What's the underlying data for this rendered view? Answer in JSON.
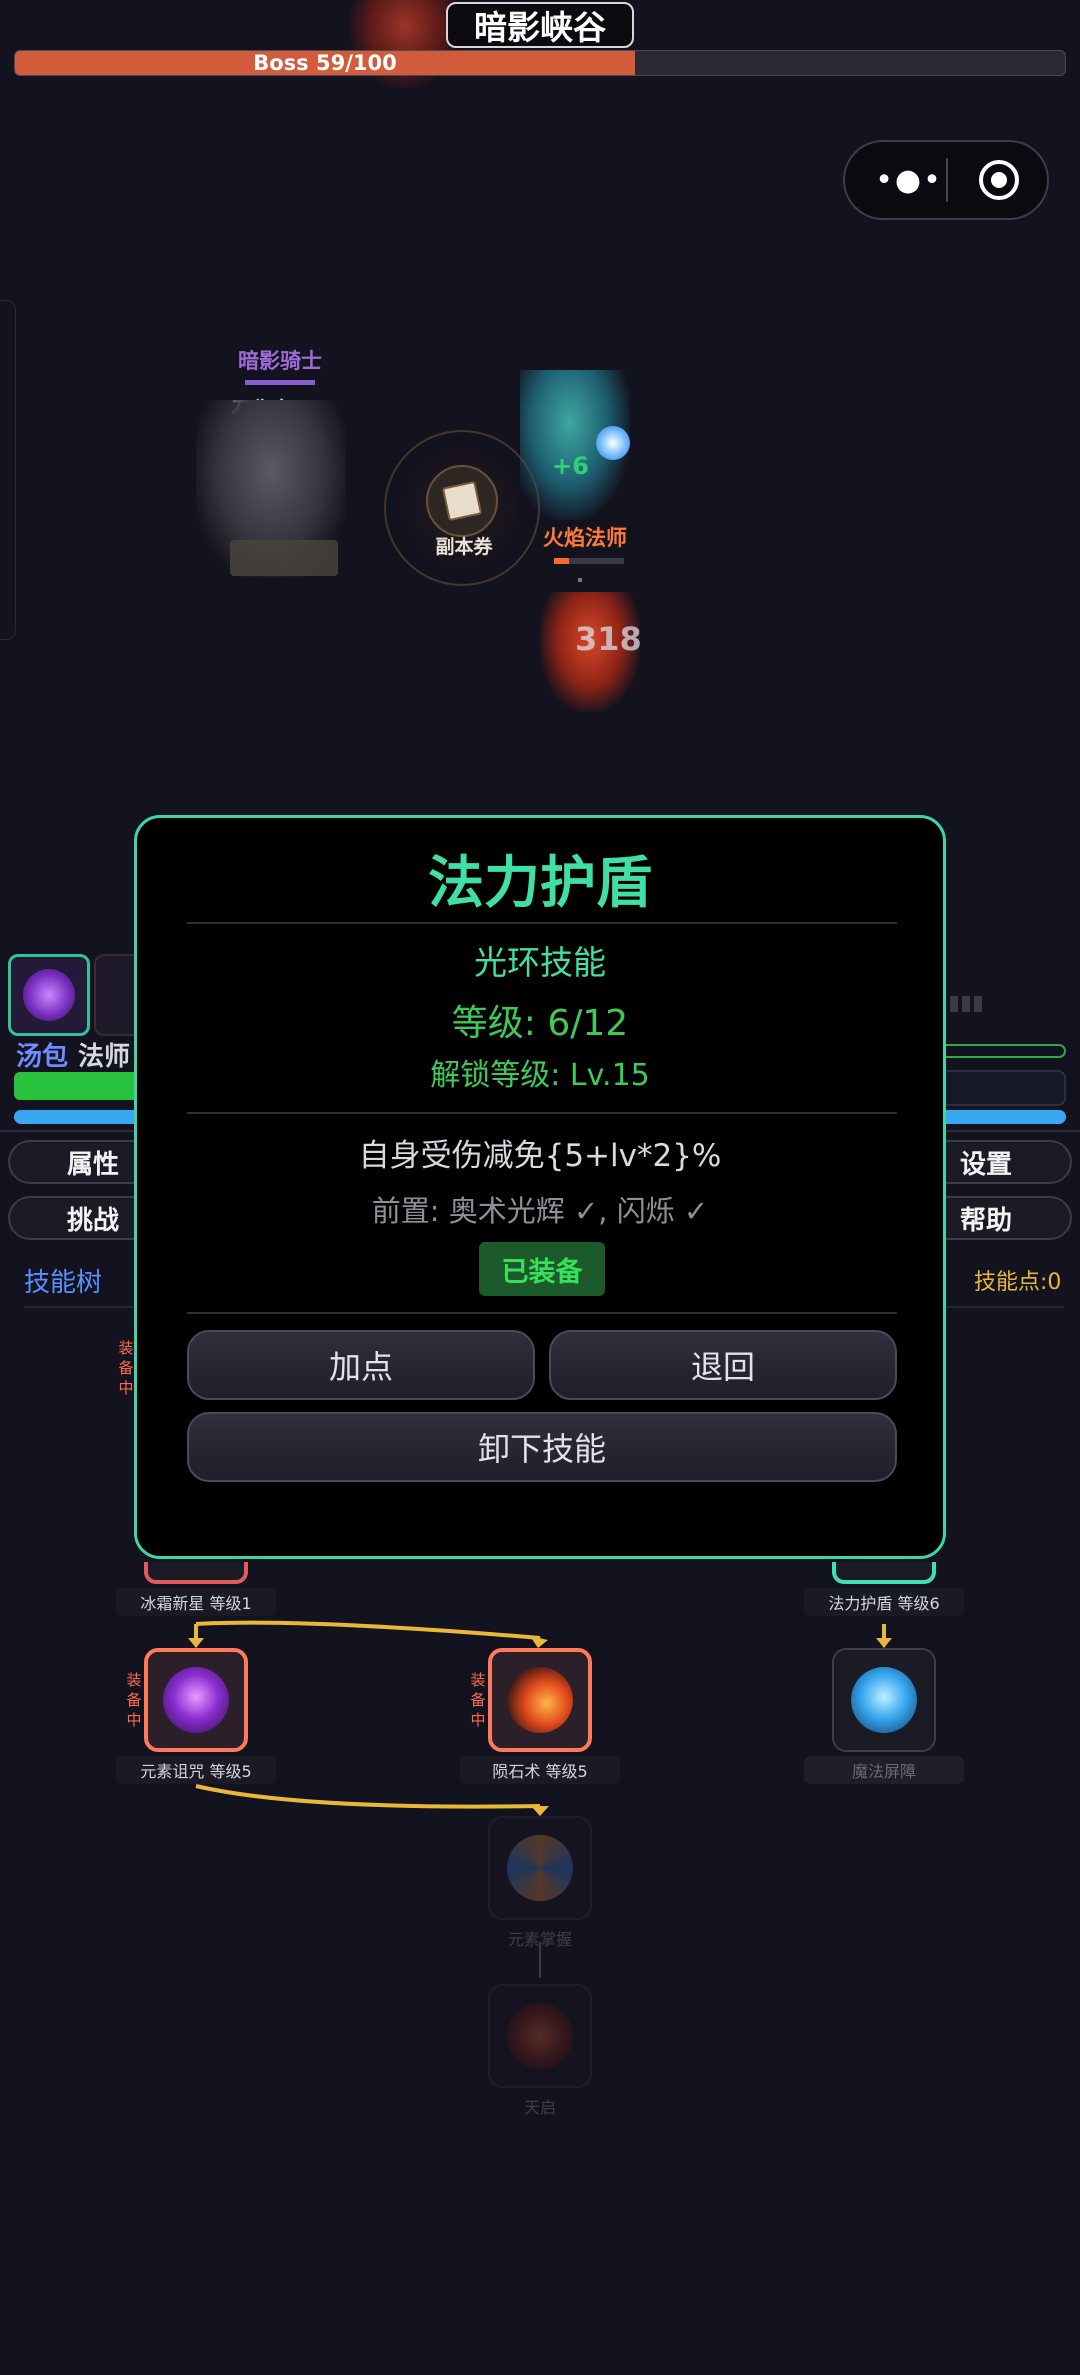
{
  "header": {
    "zone_title": "暗影峡谷",
    "boss_label": "Boss 59/100",
    "boss_progress": 0.59
  },
  "capsule": {
    "more_glyph": "•●•",
    "close_icon": "target-icon"
  },
  "battle": {
    "enemy_name": "暗影骑士",
    "enemy_sub_name": "石像鬼",
    "ticket_label": "副本券",
    "mage_float_text": "+6",
    "fire_mage_name": "火焰法师",
    "fire_mage_hp": 0.22,
    "damage_number": "318"
  },
  "hud": {
    "hero_name": "汤包",
    "hero_class": "法师",
    "buttons": {
      "attributes": "属性",
      "challenge": "挑战",
      "settings": "设置",
      "help": "帮助"
    },
    "tab_skill_tree": "技能树",
    "skill_points": "技能点:0"
  },
  "skill_tree": {
    "equip_tag": "装备中",
    "nodes": {
      "frost_nova": "冰霜新星 等级1",
      "mana_shield": "法力护盾 等级6",
      "element_curse": "元素诅咒 等级5",
      "meteor": "陨石术 等级5",
      "magic_barrier": "魔法屏障",
      "element_mastery": "元素掌握",
      "sky_fire": "天启"
    }
  },
  "modal": {
    "title": "法力护盾",
    "type": "光环技能",
    "level": "等级: 6/12",
    "unlock": "解锁等级: Lv.15",
    "effect": "自身受伤减免{5+lv*2}%",
    "prereq": "前置: 奥术光辉 ✓, 闪烁 ✓",
    "equipped_badge": "已装备",
    "btn_add": "加点",
    "btn_back": "退回",
    "btn_unequip": "卸下技能"
  },
  "colors": {
    "accent": "#41d4a8",
    "boss_bar": "#d15b3b",
    "equipped_border": "#ff7a5a",
    "tree_line": "#e8b836"
  }
}
